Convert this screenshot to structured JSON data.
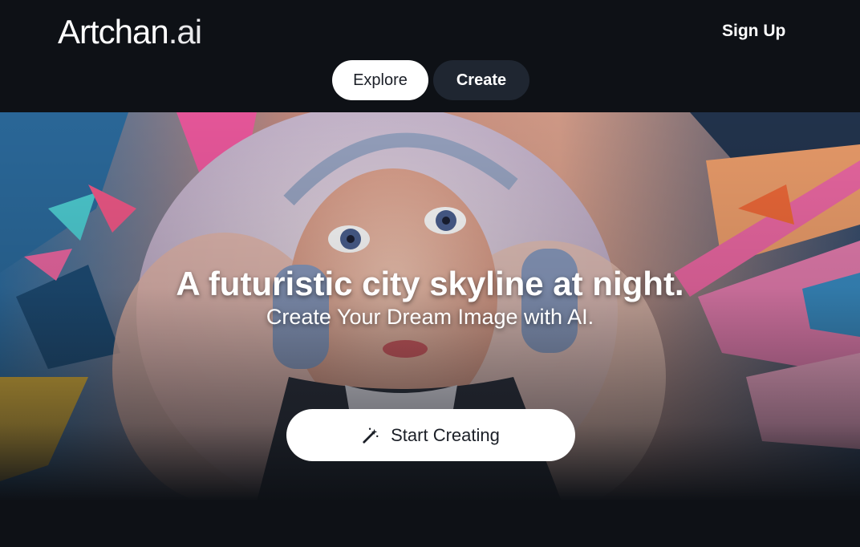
{
  "header": {
    "logo_main": "Artchan",
    "logo_suffix": ".ai",
    "signup_label": "Sign Up",
    "tabs": [
      {
        "label": "Explore",
        "active": true
      },
      {
        "label": "Create",
        "active": false
      }
    ]
  },
  "hero": {
    "headline": "A futuristic city skyline at night.",
    "subline": "Create Your Dream Image with AI.",
    "cta_label": "Start Creating",
    "cta_icon": "magic-wand-icon"
  },
  "colors": {
    "background": "#0e1116",
    "tab_active_bg": "#ffffff",
    "tab_inactive_bg": "#1f2631",
    "accent_pink": "#f06aa6",
    "accent_blue": "#3a8fc7"
  }
}
